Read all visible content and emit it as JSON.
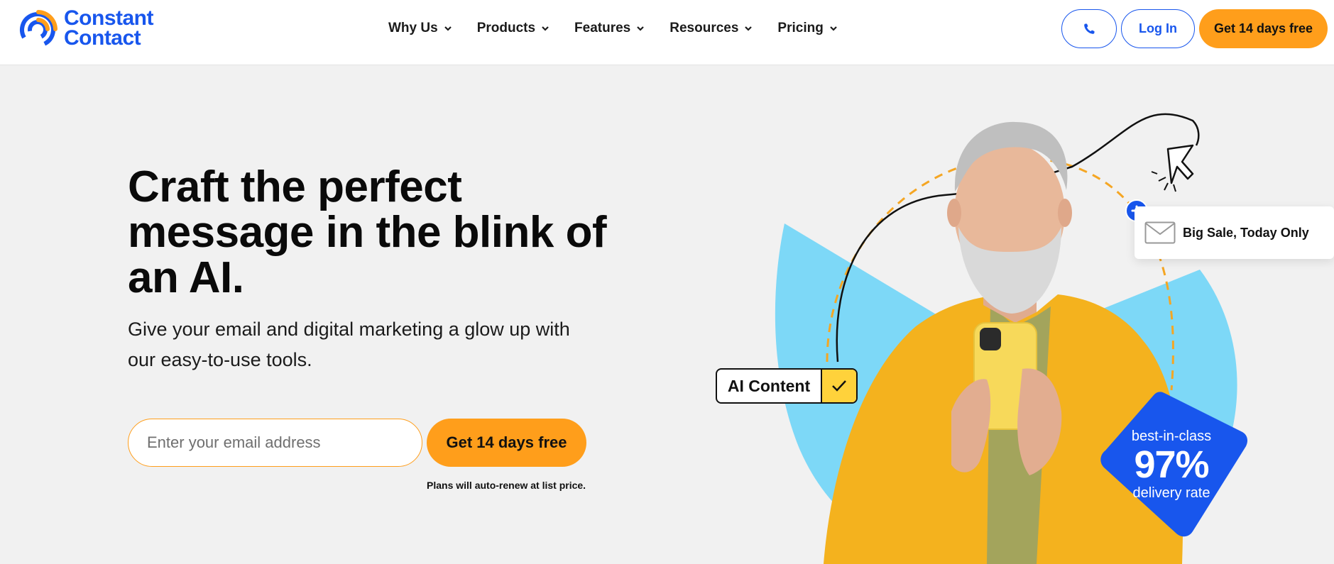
{
  "brand": {
    "name_line1": "Constant",
    "name_line2": "Contact",
    "color": "#1856ed",
    "accent": "#ff9e1b"
  },
  "nav": {
    "items": [
      {
        "label": "Why Us",
        "icon": "chevron-down-icon"
      },
      {
        "label": "Products",
        "icon": "chevron-down-icon"
      },
      {
        "label": "Features",
        "icon": "chevron-down-icon"
      },
      {
        "label": "Resources",
        "icon": "chevron-down-icon"
      },
      {
        "label": "Pricing",
        "icon": "chevron-down-icon"
      }
    ]
  },
  "header_actions": {
    "phone_icon": "phone-icon",
    "login_label": "Log In",
    "trial_label": "Get 14 days free"
  },
  "hero": {
    "headline": "Craft the perfect message in the blink of an AI.",
    "subhead": "Give your email and digital marketing a glow up with our easy-to-use tools.",
    "email_placeholder": "Enter your email address",
    "email_value": "",
    "cta_label": "Get 14 days free",
    "disclaimer": "Plans will auto-renew at list price."
  },
  "illustration": {
    "ai_tag_label": "AI Content",
    "ai_tag_icon": "checkmark-icon",
    "sale_card_text": "Big Sale, Today Only",
    "sale_card_icon": "envelope-icon",
    "plus_icon": "plus-icon",
    "cursor_icon": "cursor-arrow-icon",
    "stat_small_top": "best-in-class",
    "stat_big": "97%",
    "stat_small_bottom": "delivery rate",
    "colors": {
      "sky": "#7dd8f7",
      "jacket": "#f4b21e",
      "badge": "#1856ed",
      "tag_check": "#ffd23b"
    }
  }
}
